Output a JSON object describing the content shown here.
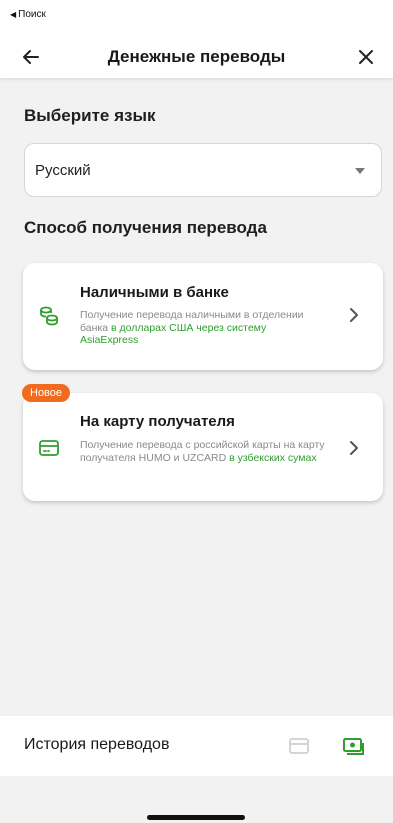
{
  "status_bar": {
    "back_text": "Поиск"
  },
  "header": {
    "title": "Денежные переводы",
    "back_icon": "arrow-left-icon",
    "close_icon": "close-icon"
  },
  "language": {
    "heading": "Выберите язык",
    "selected": "Русский"
  },
  "method": {
    "heading": "Способ получения перевода",
    "options": [
      {
        "title": "Наличными в банке",
        "desc_plain": "Получение перевода наличными в отделении банка ",
        "desc_green": "в долларах США через систему AsiaExpress",
        "icon": "coins-icon"
      },
      {
        "badge": "Новое",
        "title": "На карту получателя",
        "desc_plain": "Получение перевода с российской карты на карту получателя HUMO и UZCARD ",
        "desc_green": "в узбекских сумах",
        "icon": "card-icon"
      }
    ]
  },
  "bottom": {
    "history_label": "История переводов"
  },
  "colors": {
    "accent_green": "#2f9e2f",
    "badge_orange": "#f26a1b"
  }
}
